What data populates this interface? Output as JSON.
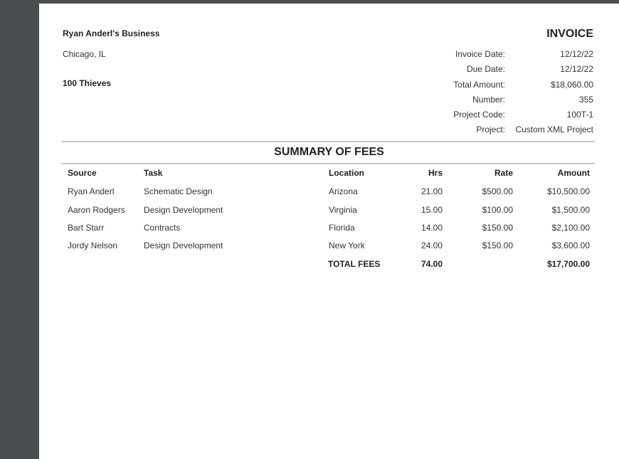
{
  "business": {
    "name": "Ryan Anderl's Business",
    "location": "Chicago, IL",
    "client": "100 Thieves"
  },
  "invoice": {
    "title": "INVOICE",
    "fields": [
      {
        "label": "Invoice Date:",
        "value": "12/12/22"
      },
      {
        "label": "Due Date:",
        "value": "12/12/22"
      },
      {
        "label": "Total Amount:",
        "value": "$18,060.00"
      },
      {
        "label": "Number:",
        "value": "355"
      },
      {
        "label": "Project Code:",
        "value": "100T-1"
      },
      {
        "label": "Project:",
        "value": "Custom XML Project"
      }
    ]
  },
  "summary": {
    "title": "SUMMARY OF FEES",
    "headers": {
      "source": "Source",
      "task": "Task",
      "location": "Location",
      "hrs": "Hrs",
      "rate": "Rate",
      "amount": "Amount"
    },
    "rows": [
      {
        "source": "Ryan Anderl",
        "task": "Schematic Design",
        "location": "Arizona",
        "hrs": "21.00",
        "rate": "$500.00",
        "amount": "$10,500.00"
      },
      {
        "source": "Aaron Rodgers",
        "task": "Design Development",
        "location": "Virginia",
        "hrs": "15.00",
        "rate": "$100.00",
        "amount": "$1,500.00"
      },
      {
        "source": "Bart Starr",
        "task": "Contracts",
        "location": "Florida",
        "hrs": "14.00",
        "rate": "$150.00",
        "amount": "$2,100.00"
      },
      {
        "source": "Jordy Nelson",
        "task": "Design Development",
        "location": "New York",
        "hrs": "24.00",
        "rate": "$150.00",
        "amount": "$3,600.00"
      }
    ],
    "total": {
      "label": "TOTAL FEES",
      "hrs": "74.00",
      "amount": "$17,700.00"
    }
  }
}
